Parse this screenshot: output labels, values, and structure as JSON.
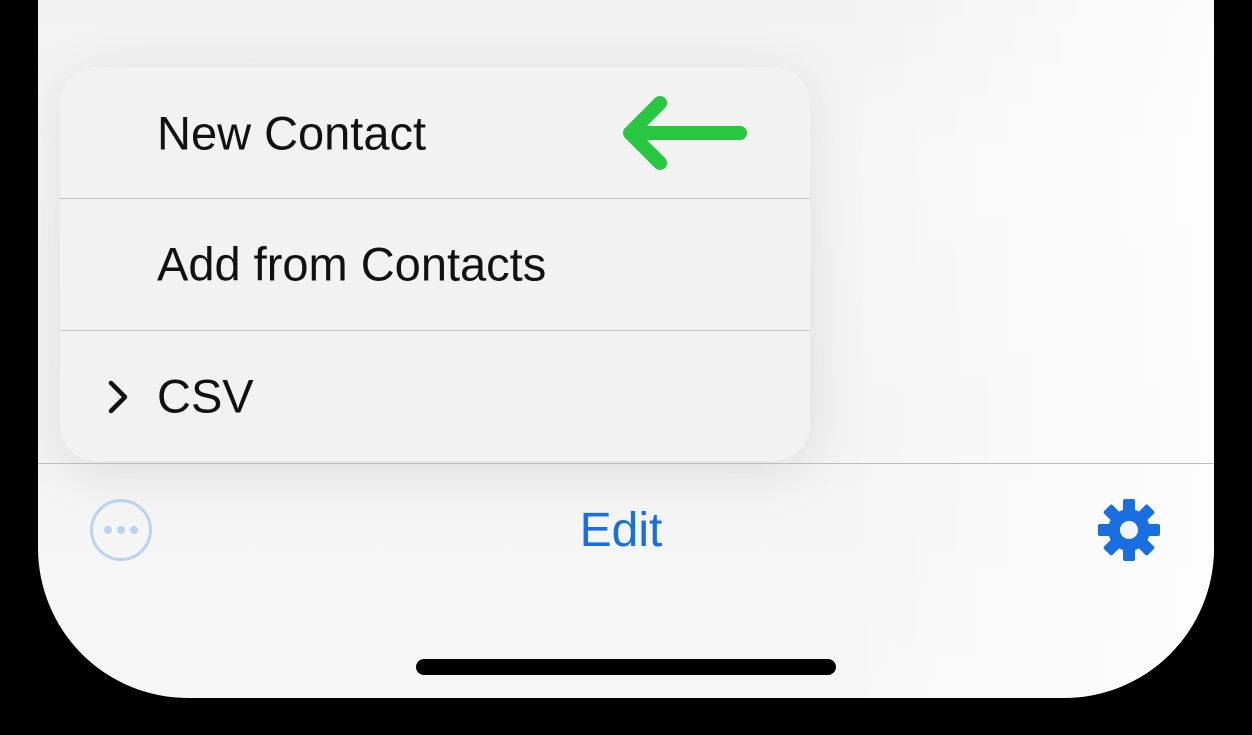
{
  "menu": {
    "items": [
      {
        "label": "New Contact"
      },
      {
        "label": "Add from Contacts"
      },
      {
        "label": "CSV",
        "has_submenu": true
      }
    ],
    "highlight_arrow_color": "#27c840"
  },
  "toolbar": {
    "more_icon": "ellipsis-circle-icon",
    "edit_label": "Edit",
    "settings_icon": "gear-icon",
    "accent_color": "#1a6fe0",
    "more_color": "#b9d3ee"
  }
}
